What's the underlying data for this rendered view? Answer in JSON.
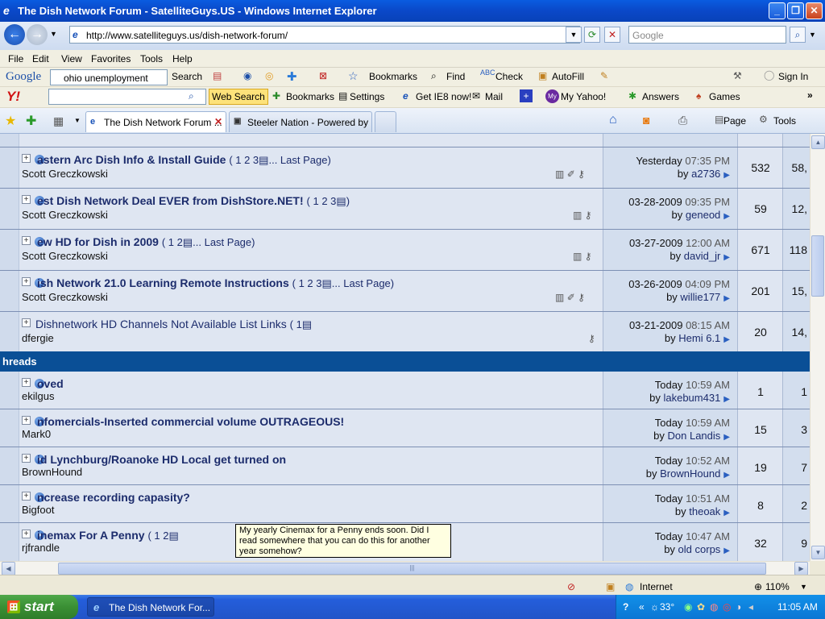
{
  "window": {
    "title": "The Dish Network Forum - SatelliteGuys.US - Windows Internet Explorer"
  },
  "address": {
    "url": "http://www.satelliteguys.us/dish-network-forum/",
    "search_placeholder": "Google"
  },
  "menu": [
    "File",
    "Edit",
    "View",
    "Favorites",
    "Tools",
    "Help"
  ],
  "google_toolbar": {
    "logo": "Google",
    "query": "ohio unemployment",
    "search_label": "Search",
    "bookmarks_label": "Bookmarks",
    "find_label": "Find",
    "check_label": "Check",
    "autofill_label": "AutoFill",
    "signin_label": "Sign In"
  },
  "yahoo_toolbar": {
    "logo": "Y!",
    "web_search_label": "Web Search",
    "bookmarks_label": "Bookmarks",
    "settings_label": "Settings",
    "ie8_label": "Get IE8 now!",
    "mail_label": "Mail",
    "myyahoo_label": "My Yahoo!",
    "answers_label": "Answers",
    "games_label": "Games"
  },
  "tabs": [
    {
      "label": "The Dish Network Forum ..."
    },
    {
      "label": "Steeler Nation - Powered by ..."
    }
  ],
  "command_bar": {
    "page_label": "Page",
    "tools_label": "Tools"
  },
  "sticky_threads": [
    {
      "title": "astern Arc Dish Info & Install Guide",
      "pages": "( 1 2 3",
      "last_page": "... Last Page)",
      "author": "Scott Greczkowski",
      "date": "Yesterday",
      "time": "07:35 PM",
      "by": "a2736",
      "replies": "532",
      "views": "58,"
    },
    {
      "title": "est Dish Network Deal EVER from DishStore.NET!",
      "pages": "( 1 2 3",
      "last_page": ")",
      "author": "Scott Greczkowski",
      "date": "03-28-2009",
      "time": "09:35 PM",
      "by": "geneod",
      "replies": "59",
      "views": "12,"
    },
    {
      "title": "ew HD for Dish in 2009",
      "pages": "( 1 2",
      "last_page": "... Last Page)",
      "author": "Scott Greczkowski",
      "date": "03-27-2009",
      "time": "12:00 AM",
      "by": "david_jr",
      "replies": "671",
      "views": "118"
    },
    {
      "title": "ish Network 21.0 Learning Remote Instructions",
      "pages": "( 1 2 3",
      "last_page": "... Last Page)",
      "author": "Scott Greczkowski",
      "date": "03-26-2009",
      "time": "04:09 PM",
      "by": "willie177",
      "replies": "201",
      "views": "15,"
    },
    {
      "title": "Dishnetwork HD Channels Not Available List Links",
      "pages": "( 1",
      "last_page": ")",
      "author": "dfergie",
      "date": "03-21-2009",
      "time": "08:15 AM",
      "by": "Hemi 6.1",
      "replies": "20",
      "views": "14,"
    }
  ],
  "section_header": "hreads",
  "threads": [
    {
      "title": "oved",
      "pages": "",
      "author": "ekilgus",
      "date": "Today",
      "time": "10:59 AM",
      "by": "lakebum431",
      "replies": "1",
      "views": "1"
    },
    {
      "title": "nfomercials-Inserted commercial volume OUTRAGEOUS!",
      "pages": "",
      "author": "Mark0",
      "date": "Today",
      "time": "10:59 AM",
      "by": "Don Landis",
      "replies": "15",
      "views": "3"
    },
    {
      "title": "id Lynchburg/Roanoke HD Local get turned on",
      "pages": "",
      "author": "BrownHound",
      "date": "Today",
      "time": "10:52 AM",
      "by": "BrownHound",
      "replies": "19",
      "views": "7"
    },
    {
      "title": "ncrease recording capasity?",
      "pages": "",
      "author": "Bigfoot",
      "date": "Today",
      "time": "10:51 AM",
      "by": "theoak",
      "replies": "8",
      "views": "2"
    },
    {
      "title": "inemax For A Penny",
      "pages": "( 1 2",
      "author": "rjfrandle",
      "date": "Today",
      "time": "10:47 AM",
      "by": "old corps",
      "replies": "32",
      "views": "9"
    }
  ],
  "by_prefix": "by",
  "tooltip": "My yearly Cinemax for a Penny ends soon.  Did I read somewhere that you can do this for another year somehow?",
  "status": {
    "zone": "Internet",
    "zoom": "110%"
  },
  "taskbar": {
    "start": "start",
    "task": "The Dish Network For...",
    "temp": "33°",
    "clock": "11:05 AM"
  }
}
